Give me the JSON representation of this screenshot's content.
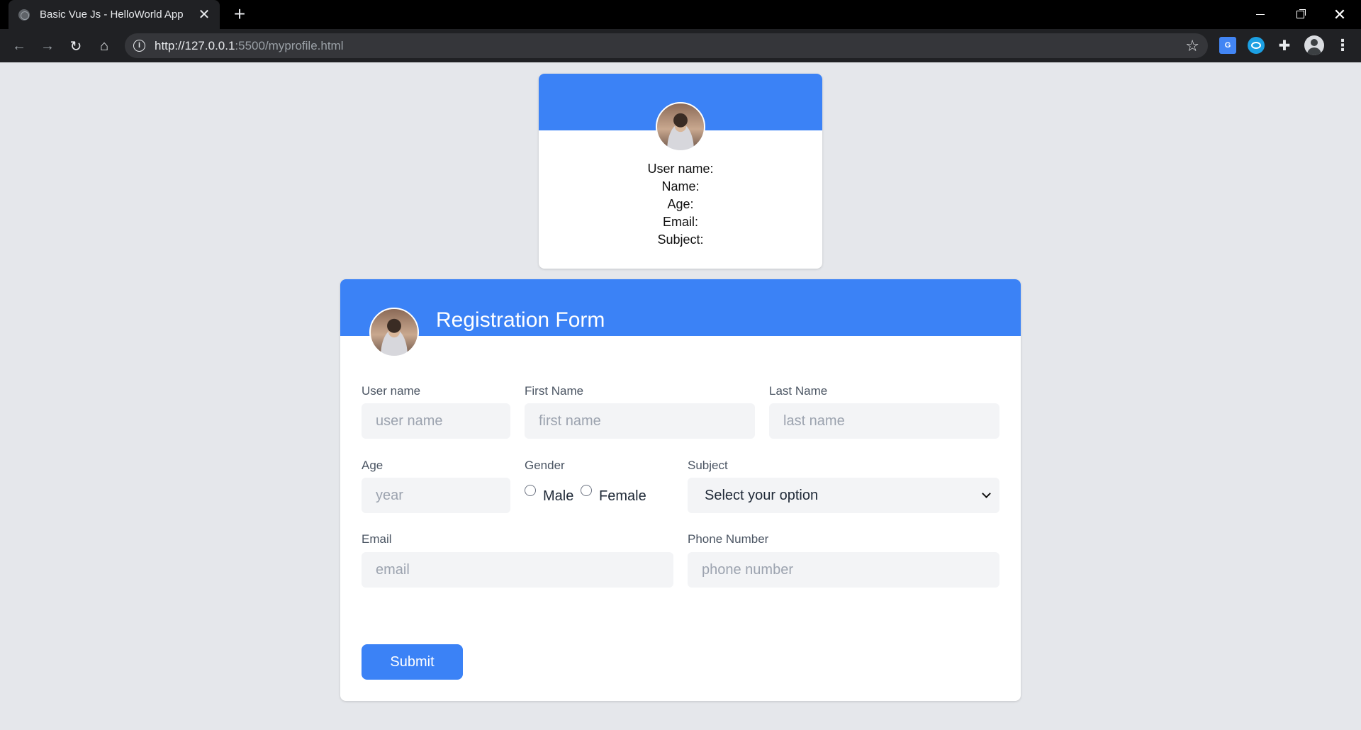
{
  "browser": {
    "tab_title": "Basic Vue Js - HelloWorld App",
    "tab_close": "✕",
    "new_tab": "+",
    "url_host": "http://127.0.0.1",
    "url_path": ":5500/myprofile.html",
    "translate_icon": "G"
  },
  "profile_card": {
    "fields": [
      "User name:",
      "Name:",
      "Age:",
      "Email:",
      "Subject:"
    ]
  },
  "form": {
    "title": "Registration Form",
    "username": {
      "label": "User name",
      "placeholder": "user name",
      "value": ""
    },
    "first_name": {
      "label": "First Name",
      "placeholder": "first name",
      "value": ""
    },
    "last_name": {
      "label": "Last Name",
      "placeholder": "last name",
      "value": ""
    },
    "age": {
      "label": "Age",
      "placeholder": "year",
      "value": ""
    },
    "gender": {
      "label": "Gender",
      "options": [
        "Male",
        "Female"
      ]
    },
    "subject": {
      "label": "Subject",
      "selected": "Select your option"
    },
    "email": {
      "label": "Email",
      "placeholder": "email",
      "value": ""
    },
    "phone": {
      "label": "Phone Number",
      "placeholder": "phone number",
      "value": ""
    },
    "submit_label": "Submit"
  },
  "colors": {
    "accent": "#3b82f6",
    "page_bg": "#e5e7eb",
    "input_bg": "#f3f4f6"
  }
}
